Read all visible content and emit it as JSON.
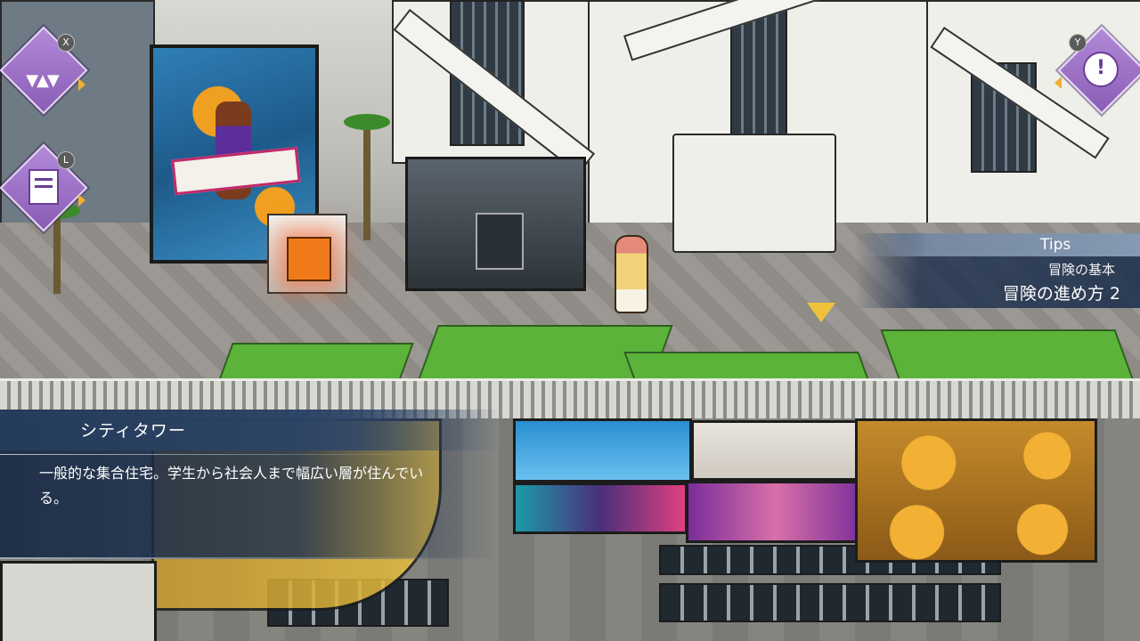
{
  "hud": {
    "top_left_button": {
      "key": "X",
      "icon": "triangles-icon"
    },
    "left_button": {
      "key": "L",
      "icon": "book-icon"
    },
    "top_right_button": {
      "key": "Y",
      "icon": "exclamation-icon",
      "glyph": "!"
    }
  },
  "tips": {
    "title": "Tips",
    "category": "冒険の基本",
    "item": "冒険の進め方 2"
  },
  "location": {
    "name": "シティタワー",
    "description": "一般的な集合住宅。学生から社会人まで幅広い層が住んでいる。"
  },
  "colors": {
    "hud_accent": "#9b6fc8",
    "panel_bg": "#1c3050",
    "glow": "#f07a1a",
    "marker": "#f0c23a"
  }
}
